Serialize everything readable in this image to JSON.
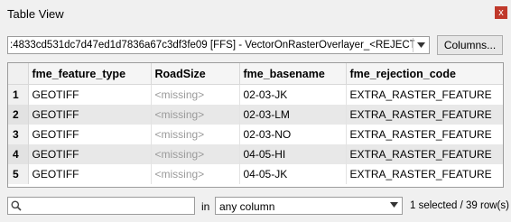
{
  "window": {
    "title": "Table View",
    "close_label": "x"
  },
  "source": {
    "value": ":4833cd531dc7d47ed1d7836a67c3df3fe09 [FFS] - VectorOnRasterOverlayer_<REJECTED>"
  },
  "toolbar": {
    "columns_label": "Columns..."
  },
  "table": {
    "headers": [
      "fme_feature_type",
      "RoadSize",
      "fme_basename",
      "fme_rejection_code"
    ],
    "rows": [
      {
        "num": "1",
        "cells": [
          "GEOTIFF",
          "<missing>",
          "02-03-JK",
          "EXTRA_RASTER_FEATURE"
        ]
      },
      {
        "num": "2",
        "cells": [
          "GEOTIFF",
          "<missing>",
          "02-03-LM",
          "EXTRA_RASTER_FEATURE"
        ]
      },
      {
        "num": "3",
        "cells": [
          "GEOTIFF",
          "<missing>",
          "02-03-NO",
          "EXTRA_RASTER_FEATURE"
        ]
      },
      {
        "num": "4",
        "cells": [
          "GEOTIFF",
          "<missing>",
          "04-05-HI",
          "EXTRA_RASTER_FEATURE"
        ]
      },
      {
        "num": "5",
        "cells": [
          "GEOTIFF",
          "<missing>",
          "04-05-JK",
          "EXTRA_RASTER_FEATURE"
        ]
      }
    ]
  },
  "search": {
    "value": "",
    "in_label": "in",
    "column_filter": "any column"
  },
  "status": {
    "text": "1 selected / 39 row(s)"
  },
  "colors": {
    "close": "#c0392b",
    "alt_row": "#e8e8e8",
    "missing_text": "#9a9a9a"
  },
  "icons": {
    "search": "search-icon",
    "dropdown": "chevron-down-icon",
    "close": "close-icon"
  }
}
